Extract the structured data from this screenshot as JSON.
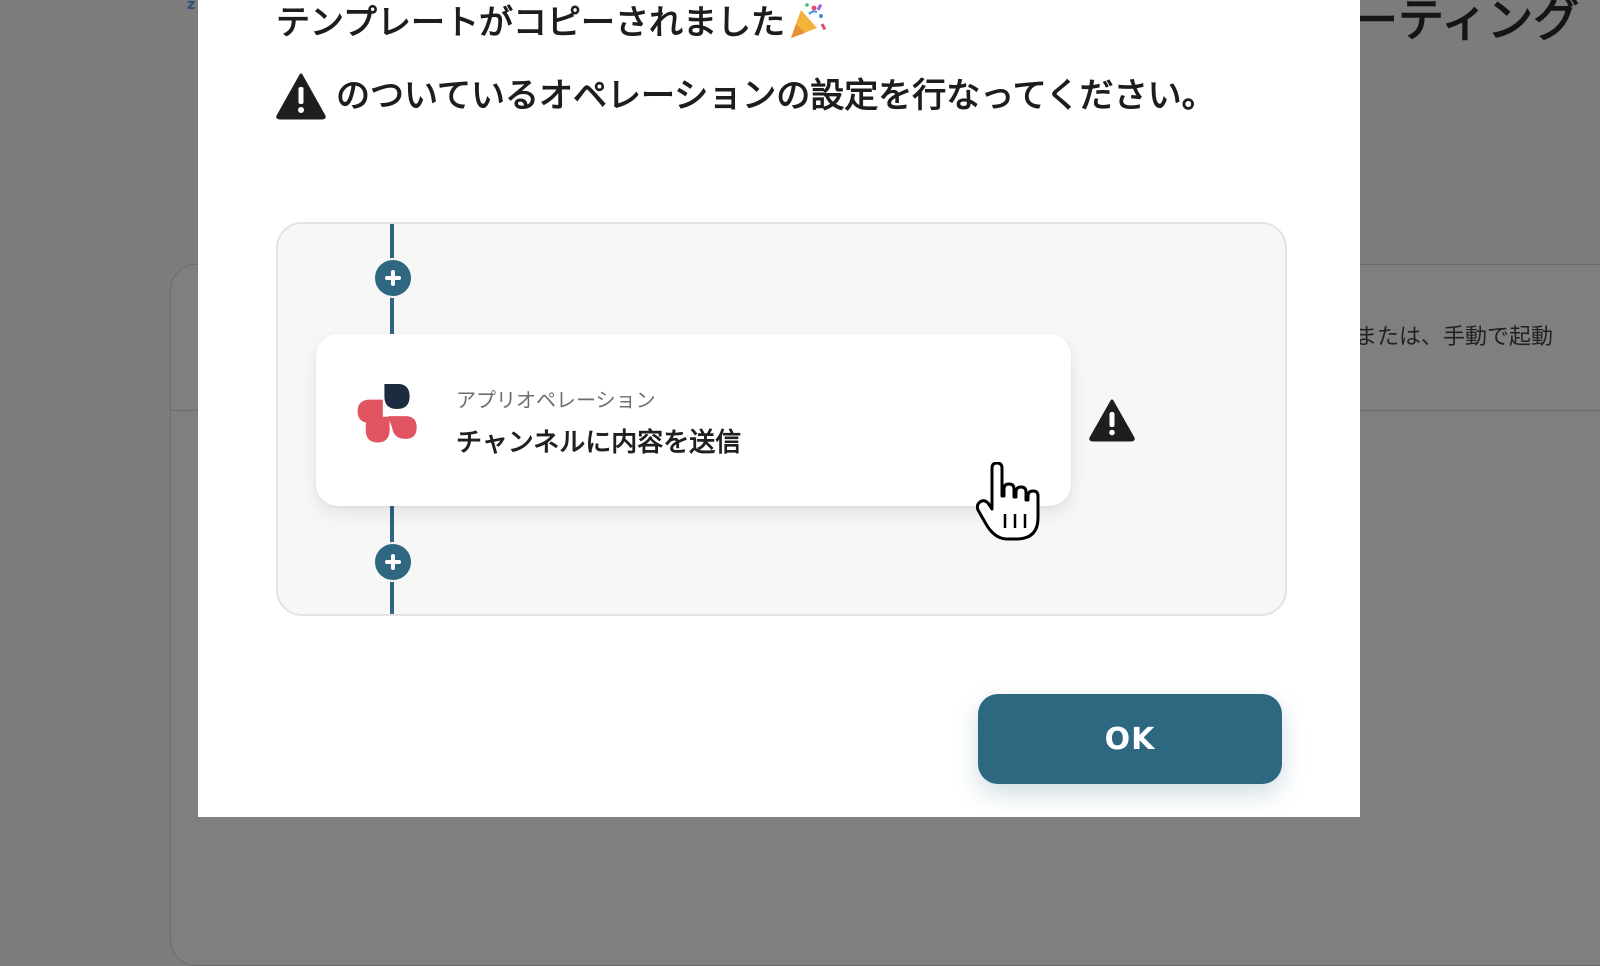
{
  "background": {
    "heading_fragment": "ーティング",
    "text_fragment": "または、手動で起動",
    "mark": "z"
  },
  "modal": {
    "title": "テンプレートがコピーされました",
    "title_icon": "party-popper-icon",
    "instruction": "のついているオペレーションの設定を行なってください。",
    "instruction_icon": "warning-icon",
    "operation": {
      "type_label": "アプリオペレーション",
      "name": "チャンネルに内容を送信",
      "app_icon": "app-logo-icon",
      "status_icon": "warning-icon"
    },
    "ok_label": "OK"
  },
  "colors": {
    "accent": "#2d6780",
    "warning": "#1e1e1e",
    "logo_red": "#e05561",
    "logo_navy": "#1c2b3f",
    "overlay": "#7c7c7c"
  }
}
